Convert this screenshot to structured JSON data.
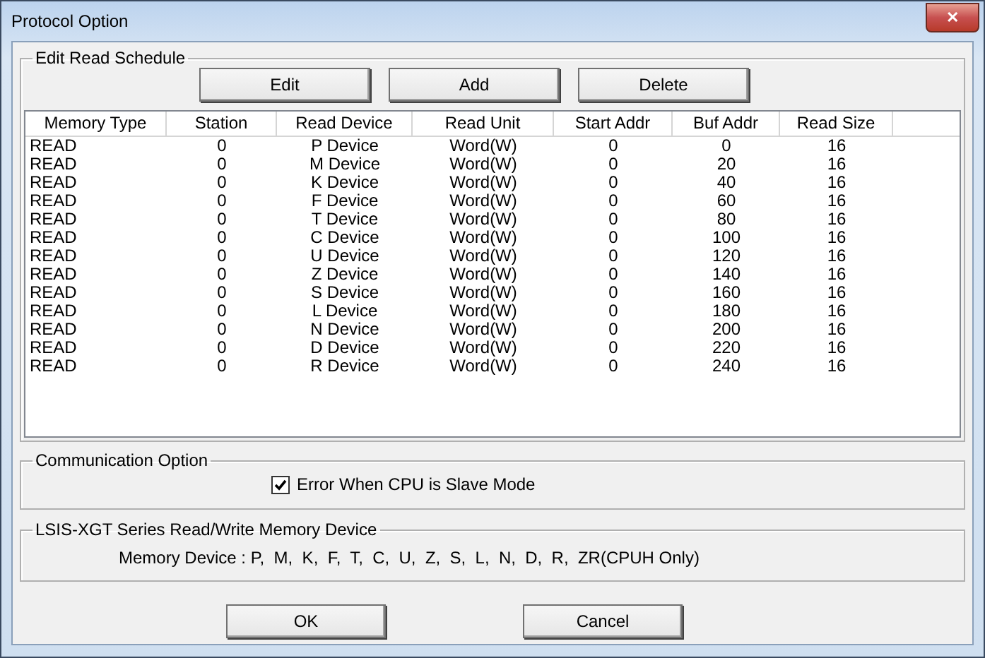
{
  "window": {
    "title": "Protocol Option",
    "close": "✕"
  },
  "edit_read_schedule": {
    "title": "Edit Read Schedule",
    "buttons": [
      "Edit",
      "Add",
      "Delete"
    ],
    "table": {
      "columns": [
        "Memory Type",
        "Station",
        "Read Device",
        "Read Unit",
        "Start Addr",
        "Buf Addr",
        "Read Size"
      ],
      "rows": [
        [
          "READ",
          "0",
          "P Device",
          "Word(W)",
          "0",
          "0",
          "16"
        ],
        [
          "READ",
          "0",
          "M Device",
          "Word(W)",
          "0",
          "20",
          "16"
        ],
        [
          "READ",
          "0",
          "K Device",
          "Word(W)",
          "0",
          "40",
          "16"
        ],
        [
          "READ",
          "0",
          "F Device",
          "Word(W)",
          "0",
          "60",
          "16"
        ],
        [
          "READ",
          "0",
          "T Device",
          "Word(W)",
          "0",
          "80",
          "16"
        ],
        [
          "READ",
          "0",
          "C Device",
          "Word(W)",
          "0",
          "100",
          "16"
        ],
        [
          "READ",
          "0",
          "U Device",
          "Word(W)",
          "0",
          "120",
          "16"
        ],
        [
          "READ",
          "0",
          "Z Device",
          "Word(W)",
          "0",
          "140",
          "16"
        ],
        [
          "READ",
          "0",
          "S Device",
          "Word(W)",
          "0",
          "160",
          "16"
        ],
        [
          "READ",
          "0",
          "L Device",
          "Word(W)",
          "0",
          "180",
          "16"
        ],
        [
          "READ",
          "0",
          "N Device",
          "Word(W)",
          "0",
          "200",
          "16"
        ],
        [
          "READ",
          "0",
          "D Device",
          "Word(W)",
          "0",
          "220",
          "16"
        ],
        [
          "READ",
          "0",
          "R Device",
          "Word(W)",
          "0",
          "240",
          "16"
        ]
      ]
    }
  },
  "communication_option": {
    "title": "Communication Option",
    "checkbox": {
      "label": "Error When CPU is Slave Mode",
      "checked": true
    }
  },
  "memory_device_group": {
    "title": "LSIS-XGT Series Read/Write Memory Device",
    "text": "Memory Device : P,  M,  K,  F,  T,  C,  U,  Z,  S,  L,  N,  D,  R,  ZR(CPUH Only)"
  },
  "buttons": [
    "OK",
    "Cancel"
  ]
}
